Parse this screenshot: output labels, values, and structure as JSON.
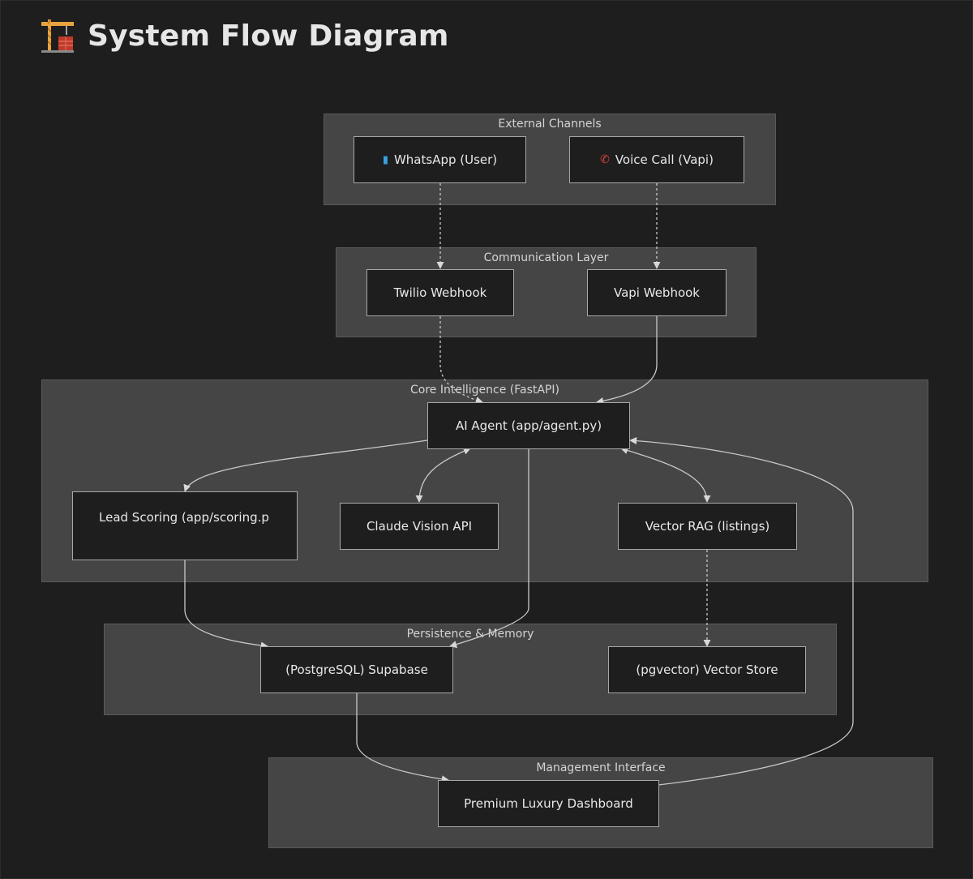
{
  "page": {
    "title": "System Flow Diagram",
    "title_icon": "construction-crane-icon"
  },
  "groups": {
    "external": "External Channels",
    "communication": "Communication Layer",
    "core": "Core Intelligence (FastAPI)",
    "persistence": "Persistence & Memory",
    "management": "Management Interface"
  },
  "nodes": {
    "whatsapp": {
      "label": "WhatsApp (User)",
      "icon": "mobile-phone-icon"
    },
    "voice": {
      "label": "Voice Call (Vapi)",
      "icon": "telephone-receiver-icon"
    },
    "twilio": {
      "label": "Twilio Webhook"
    },
    "vapi": {
      "label": "Vapi Webhook"
    },
    "agent": {
      "label": "AI Agent (app/agent.py)"
    },
    "scoring": {
      "label": "Lead Scoring (app/scoring.p"
    },
    "claude": {
      "label": "Claude Vision API"
    },
    "rag": {
      "label": "Vector RAG (listings)"
    },
    "supabase": {
      "label": "(PostgreSQL) Supabase"
    },
    "vectorstore": {
      "label": "(pgvector) Vector Store"
    },
    "dashboard": {
      "label": "Premium Luxury Dashboard"
    }
  },
  "colors": {
    "background": "#1e1e1e",
    "group_fill": "#454545",
    "node_fill": "#1e1e1e",
    "node_border": "#a8a8a8",
    "edge": "#c9c9c9"
  }
}
